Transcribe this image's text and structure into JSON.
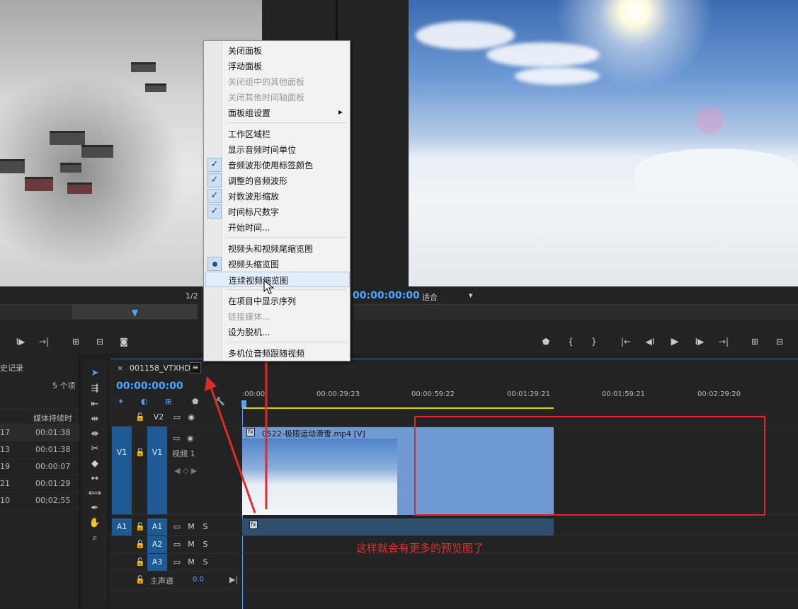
{
  "source_monitor": {
    "fraction": "1/2"
  },
  "program_monitor": {
    "timecode": "00:00:00:00",
    "fit_label": "适合"
  },
  "history_panel": {
    "title": "史记录",
    "count": "5 个项",
    "column_header": "媒体持续时",
    "rows": [
      {
        "c1": "17",
        "c2": "00:01:38"
      },
      {
        "c1": "13",
        "c2": "00:01:38"
      },
      {
        "c1": "19",
        "c2": "00:00:07"
      },
      {
        "c1": "21",
        "c2": "00:01:29"
      },
      {
        "c1": "10",
        "c2": "00;02;55"
      }
    ]
  },
  "timeline": {
    "tab_close": "×",
    "tab_name": "001158_VTXHD",
    "menu_icon": "≡",
    "timecode": "00:00:00:00",
    "ruler_ticks": [
      ":00:00",
      "00:00:29:23",
      "00:00:59:22",
      "00:01:29:21",
      "00:01:59:21",
      "00:02:29:20"
    ],
    "tracks": {
      "v2": {
        "label": "V2"
      },
      "v1": {
        "src": "V1",
        "label": "V1",
        "name": "视频 1"
      },
      "a1": {
        "src": "A1",
        "label": "A1",
        "m": "M",
        "s": "S"
      },
      "a2": {
        "label": "A2",
        "m": "M",
        "s": "S"
      },
      "a3": {
        "label": "A3",
        "m": "M",
        "s": "S"
      },
      "master": {
        "label": "主声道",
        "value": "0.0"
      }
    },
    "clip_name": "0522-极限运动滑雪.mp4 [V]",
    "fx_badge": "fx"
  },
  "context_menu": {
    "items": [
      {
        "label": "关闭面板",
        "state": "normal"
      },
      {
        "label": "浮动面板",
        "state": "normal"
      },
      {
        "label": "关闭组中的其他面板",
        "state": "disabled"
      },
      {
        "label": "关闭其他时间轴面板",
        "state": "disabled"
      },
      {
        "label": "面板组设置",
        "state": "submenu"
      },
      {
        "label": "工作区域栏",
        "state": "normal"
      },
      {
        "label": "显示音频时间单位",
        "state": "normal"
      },
      {
        "label": "音频波形使用标签颜色",
        "state": "checked"
      },
      {
        "label": "调整的音频波形",
        "state": "checked"
      },
      {
        "label": "对数波形缩放",
        "state": "checked"
      },
      {
        "label": "时间标尺数字",
        "state": "checked"
      },
      {
        "label": "开始时间...",
        "state": "normal"
      },
      {
        "label": "视频头和视频尾缩览图",
        "state": "normal"
      },
      {
        "label": "视频头缩览图",
        "state": "radio"
      },
      {
        "label": "连续视频缩览图",
        "state": "highlighted"
      },
      {
        "label": "在项目中显示序列",
        "state": "normal"
      },
      {
        "label": "链接媒体...",
        "state": "disabled"
      },
      {
        "label": "设为脱机...",
        "state": "normal"
      },
      {
        "label": "多机位音频跟随视频",
        "state": "normal"
      }
    ],
    "check_glyph": "✓",
    "submenu_glyph": "▸"
  },
  "annotation": {
    "text": "这样就会有更多的预览图了",
    "color": "#e23030"
  },
  "colors": {
    "timecode_blue": "#4aa7ff",
    "track_blue": "#1e5a93",
    "clip_blue": "#6f9ad3",
    "annotation_red": "#e02a2a"
  }
}
